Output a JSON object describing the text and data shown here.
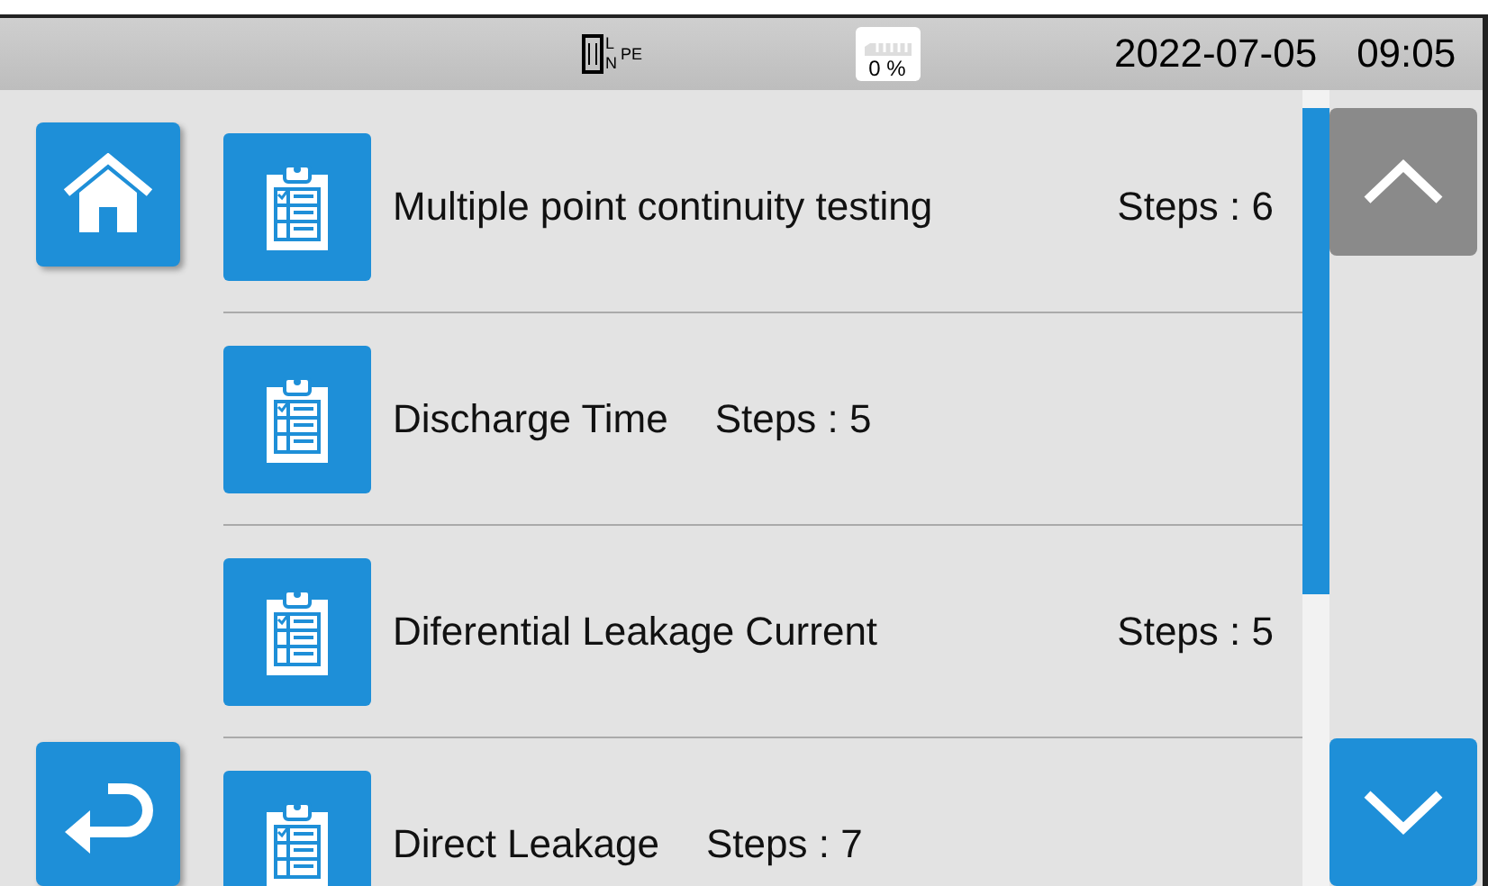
{
  "status_bar": {
    "connection": {
      "labels": [
        "L",
        "N",
        "PE"
      ]
    },
    "storage": {
      "reading": "0 %"
    },
    "date": "2022-07-05",
    "time": "09:05"
  },
  "nav": {
    "home": {
      "disabled": false
    },
    "back": {
      "disabled": false
    }
  },
  "sequences": [
    {
      "name": "Multiple point continuity testing",
      "steps": "Steps : 6",
      "kind": "spread"
    },
    {
      "name": "Discharge Time",
      "steps": "Steps : 5",
      "kind": "inline"
    },
    {
      "name": "Diferential Leakage Current",
      "steps": "Steps : 5",
      "kind": "spread"
    },
    {
      "name": "Direct Leakage",
      "steps": "Steps : 7",
      "kind": "inline"
    }
  ],
  "scroll": {
    "up": {
      "disabled": true
    },
    "down": {
      "disabled": false
    }
  }
}
